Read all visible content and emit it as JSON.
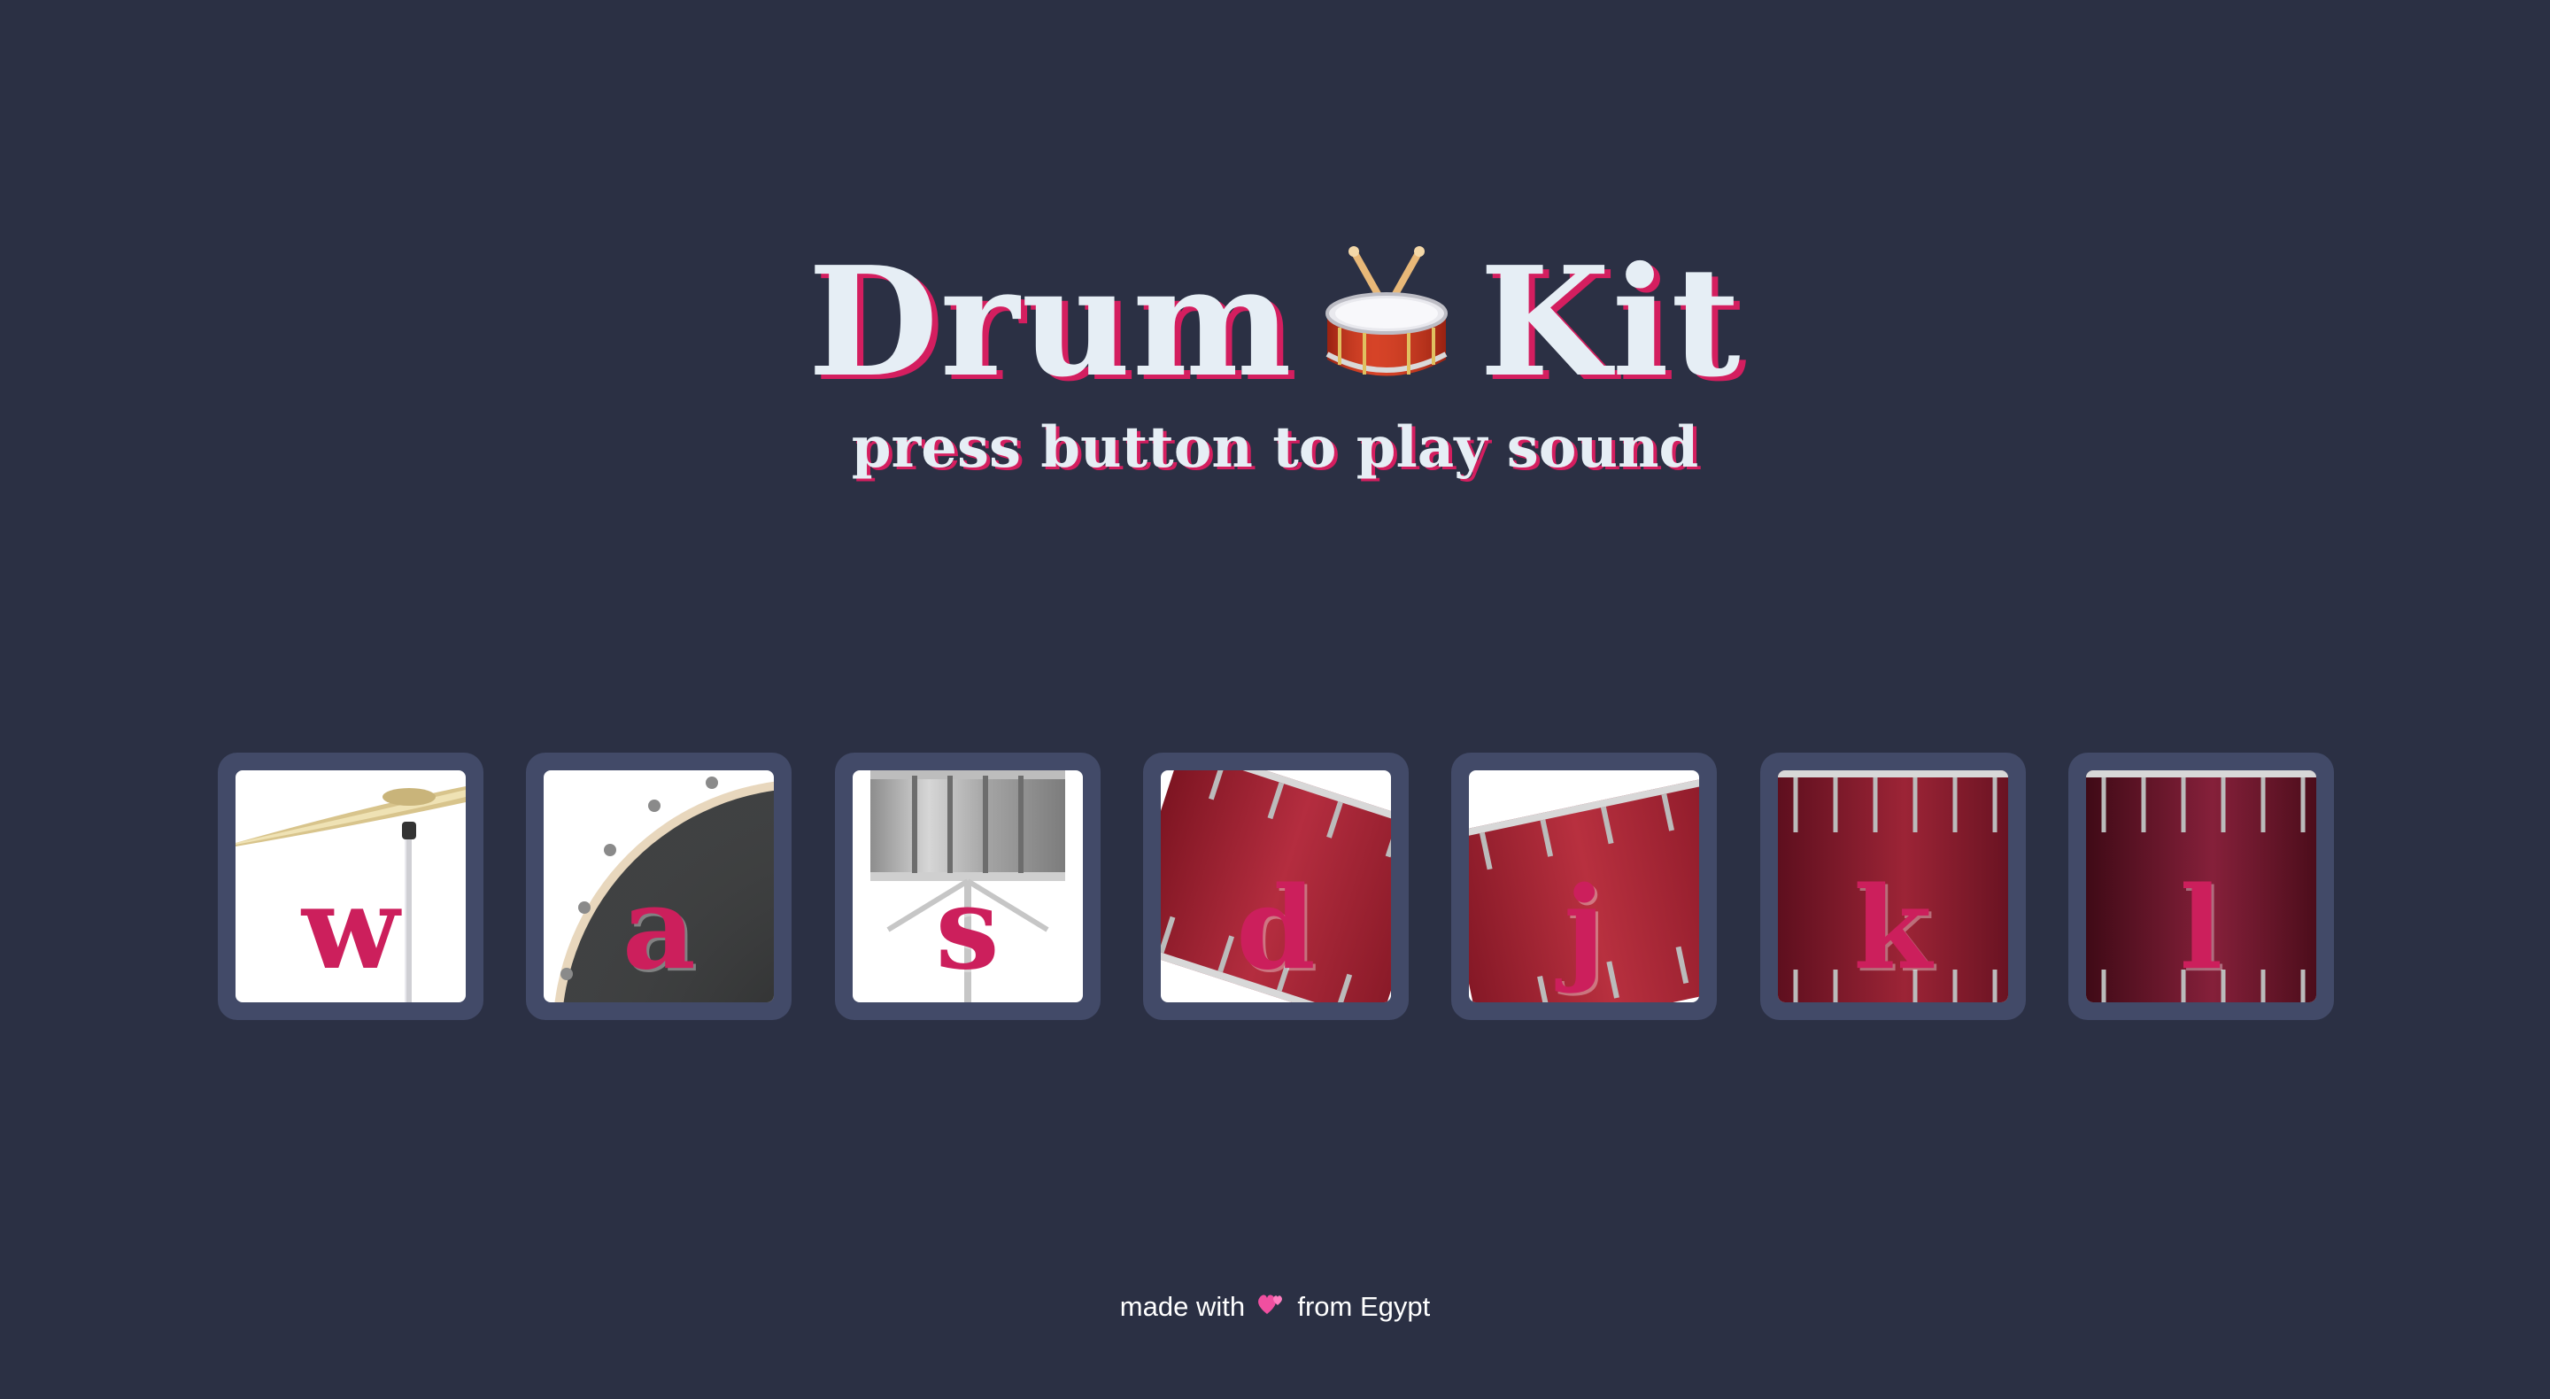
{
  "title": {
    "word1": "Drum",
    "icon": "drum-emoji",
    "word2": "Kit"
  },
  "subtitle": "press button to play sound",
  "pads": [
    {
      "key": "w",
      "instrument_icon": "crash-cymbal"
    },
    {
      "key": "a",
      "instrument_icon": "bass-drum"
    },
    {
      "key": "s",
      "instrument_icon": "snare-drum"
    },
    {
      "key": "d",
      "instrument_icon": "tom-1"
    },
    {
      "key": "j",
      "instrument_icon": "tom-2"
    },
    {
      "key": "k",
      "instrument_icon": "tom-3"
    },
    {
      "key": "l",
      "instrument_icon": "tom-4"
    }
  ],
  "footer": {
    "before": "made with",
    "icon": "two-hearts-emoji",
    "after": "from Egypt"
  },
  "colors": {
    "background": "#2b3044",
    "pad_frame": "#424a68",
    "accent": "#cc1f5c",
    "title_text": "#e6eef5"
  }
}
